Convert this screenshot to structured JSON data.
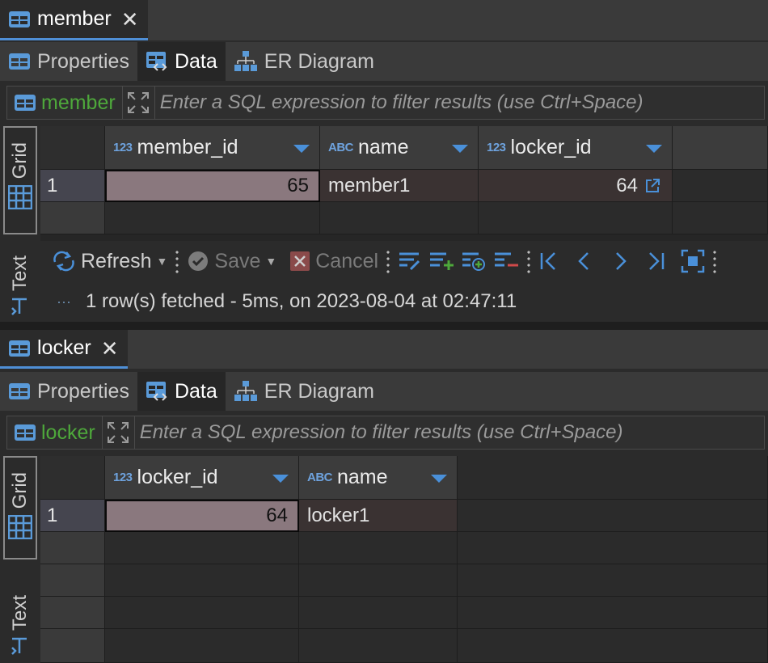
{
  "colors": {
    "accent": "#4f8fd6",
    "table_green": "#4ea83b",
    "sort_arrow": "#4a90d9",
    "selected_cell": "#8a787e"
  },
  "panels": {
    "member": {
      "tab_title": "member",
      "subtabs": [
        "Properties",
        "Data",
        "ER Diagram"
      ],
      "filter": {
        "table": "member",
        "placeholder": "Enter a SQL expression to filter results (use Ctrl+Space)"
      },
      "modes": [
        "Grid",
        "Text"
      ],
      "columns": [
        {
          "type": "123",
          "name": "member_id"
        },
        {
          "type": "ABC",
          "name": "name"
        },
        {
          "type": "123",
          "name": "locker_id"
        }
      ],
      "rows": [
        {
          "num": "1",
          "cells": [
            "65",
            "member1",
            "64"
          ]
        }
      ],
      "toolbar": {
        "refresh": "Refresh",
        "save": "Save",
        "cancel": "Cancel"
      },
      "status": "1 row(s) fetched - 5ms, on 2023-08-04 at 02:47:11"
    },
    "locker": {
      "tab_title": "locker",
      "subtabs": [
        "Properties",
        "Data",
        "ER Diagram"
      ],
      "filter": {
        "table": "locker",
        "placeholder": "Enter a SQL expression to filter results (use Ctrl+Space)"
      },
      "modes": [
        "Grid",
        "Text"
      ],
      "columns": [
        {
          "type": "123",
          "name": "locker_id"
        },
        {
          "type": "ABC",
          "name": "name"
        }
      ],
      "rows": [
        {
          "num": "1",
          "cells": [
            "64",
            "locker1"
          ]
        }
      ]
    }
  }
}
